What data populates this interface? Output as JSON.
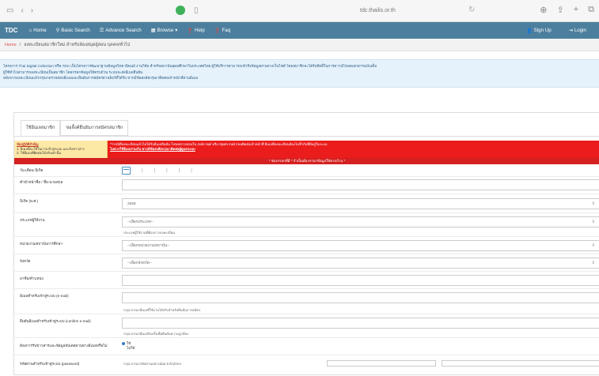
{
  "browser": {
    "url": "tdc.thailis.or.th"
  },
  "nav": {
    "brand": "TDC",
    "items": [
      "Home",
      "Basic Search",
      "Advance Search",
      "Browse",
      "Help",
      "Faq"
    ],
    "right": [
      "Sign Up",
      "Login"
    ]
  },
  "breadcrumb": {
    "home": "Home",
    "path": "ลงทะเบียนสมาชิกใหม่ สำหรับห้องสมุดผู้สอน บุคคล/ทั่วไป"
  },
  "notice": {
    "line1": "โครงการ Thai Digital Collection หรือ TDC เป็นโครงการพัฒนาฐานข้อมูลวิทยานิพนธ์ งานวิจัย สำหรับสถาบันอุดมศึกษาในประเทศไทย ผู้ใช้บริการสามารถเข้าถึงข้อมูลผ่านทางเว็บไซต์ โดยสมาชิกจะได้รับสิทธิ์ในการดาวน์โหลดเอกสารฉบับเต็ม",
    "line2": "ผู้ใช้ทั่วไปสามารถลงทะเบียนเป็นสมาชิก โดยกรอกข้อมูลให้ครบถ้วน ระบบจะส่งอีเมลยืนยัน",
    "line3": "หลังจากลงทะเบียนแล้วกรุณาตรวจสอบอีเมลและยืนยันการสมัครผ่านลิงก์ที่ได้รับ หากมีข้อสงสัยกรุณาติดต่อเจ้าหน้าที่ผ่านอีเมล"
  },
  "tabs": [
    "ใช้อีเมลสมาชิก",
    "ขอลิ้งค์ยืนยันการสมัครสมาชิก"
  ],
  "warning": {
    "left_title": "ข้อปฏิบัติสำคัญ",
    "left_items": [
      "1. อีเมลนี้จะใช้ในการเข้าสู่ระบบ และรับข่าวสาร",
      "2. ใช้อีเมลที่ติดต่อได้จริงเท่านั้น"
    ],
    "right_line1": "**กรณีที่ลงทะเบียนแล้วไม่ได้รับอีเมลยืนยัน โปรดตรวจสอบใน Junk mail หรือ Spam mail ก่อนติดต่อเจ้าหน้าที่ อีเมลที่ลงทะเบียนต้องไม่ซ้ำกับที่มีอยู่ในระบบ",
    "right_line2": "ไม่ควรใช้อีเมลร่วมกัน หากมีข้อสงสัยกรุณาติดต่อผู้ดูแลระบบ"
  },
  "required_bar": "* ช่องกรอกที่มี * จำเป็นต้องกรอกข้อมูลให้ครบถ้วน *",
  "form": [
    {
      "label": "วัน-เดือน-ปีเกิด",
      "type": "date"
    },
    {
      "label": "คำนำหน้าชื่อ / ชื่อ-นามสกุล",
      "type": "text",
      "value": ""
    },
    {
      "label": "ปีเกิด (พ.ศ.)",
      "type": "select",
      "value": "2555"
    },
    {
      "label": "ประเภทผู้ใช้งาน",
      "type": "select",
      "value": "--เลือกประเภท--",
      "hint": "ประเภทผู้ใช้งานที่ต้องการลงทะเบียน"
    },
    {
      "label": "หน่วยงาน/สถาบันการศึกษา",
      "type": "select",
      "value": "--เลือกหน่วยงาน/สถาบัน--"
    },
    {
      "label": "จังหวัด",
      "type": "select",
      "value": "--เลือกจังหวัด--"
    },
    {
      "label": "อาชีพ/ตำแหน่ง",
      "type": "text",
      "value": ""
    },
    {
      "label": "อีเมลสำหรับเข้าสู่ระบบ (e-mail)",
      "type": "text",
      "value": "",
      "hint": "กรุณากรอกอีเมลที่ใช้งานได้จริงสำหรับยืนยันการสมัคร"
    },
    {
      "label": "ยืนยันอีเมลสำหรับเข้าสู่ระบบ (confirm e-mail)",
      "type": "text",
      "value": "",
      "hint": "กรุณากรอกอีเมลอีกครั้งเพื่อยืนยันความถูกต้อง"
    },
    {
      "label": "ต้องการรับข่าวสารและข้อมูลอัปเดตผ่านทางอีเมลหรือไม่",
      "type": "radio",
      "options": [
        "ใช่",
        "ไม่ใช่"
      ]
    },
    {
      "label": "รหัสผ่านสำหรับเข้าสู่ระบบ (password)",
      "type": "text",
      "value": "",
      "hint": "กรุณากรอกรหัสผ่านอย่างน้อย 8 ตัวอักษร"
    }
  ]
}
